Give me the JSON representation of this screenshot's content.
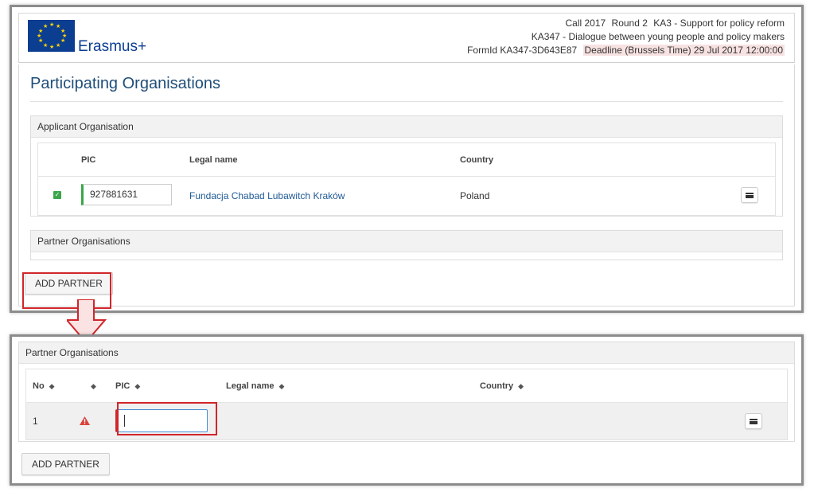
{
  "header": {
    "brand": "Erasmus+",
    "call_label": "Call 2017",
    "round_label": "Round 2",
    "action_label": "KA3 - Support for policy reform",
    "action_detail": "KA347 - Dialogue between young people and policy makers",
    "form_id": "FormId KA347-3D643E87",
    "deadline": "Deadline (Brussels Time) 29 Jul 2017 12:00:00"
  },
  "page_title": "Participating Organisations",
  "applicant": {
    "panel_title": "Applicant Organisation",
    "columns": [
      "PIC",
      "Legal name",
      "Country"
    ],
    "row": {
      "pic": "927881631",
      "legal_name": "Fundacja Chabad Lubawitch Kraków",
      "country": "Poland"
    }
  },
  "partners_collapsed": {
    "panel_title": "Partner Organisations",
    "add_button": "ADD PARTNER"
  },
  "partners_expanded": {
    "panel_title": "Partner Organisations",
    "columns": [
      "No",
      "",
      "PIC",
      "Legal name",
      "Country"
    ],
    "row": {
      "no": "1",
      "pic": ""
    },
    "add_button": "ADD PARTNER"
  },
  "colors": {
    "brand_blue": "#0b3d91",
    "title_blue": "#1f4e79",
    "link_blue": "#1f5a96",
    "success_green": "#3ba54a",
    "highlight_red": "#d0262a",
    "warning_red": "#d9413b"
  },
  "icons": {
    "check": "check-icon",
    "warning": "warning-icon",
    "menu": "hamburger-menu-icon",
    "sort": "sort-icon",
    "arrow": "down-arrow-icon"
  }
}
